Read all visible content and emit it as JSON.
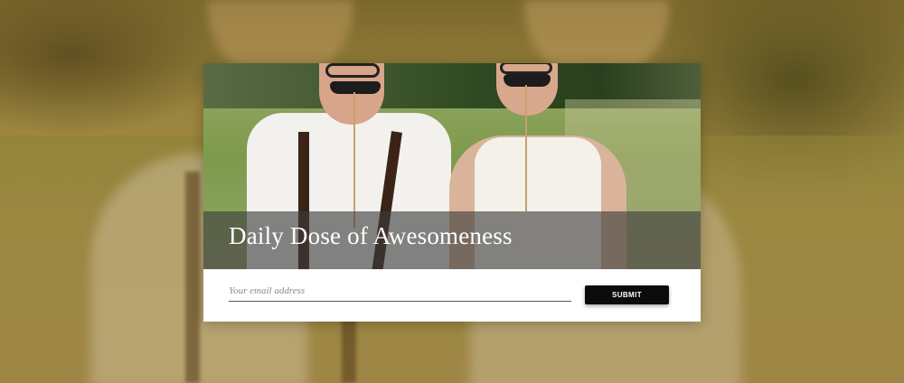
{
  "card": {
    "title": "Daily Dose of Awesomeness",
    "email_placeholder": "Your email address",
    "email_value": "",
    "submit_label": "SUBMIT"
  },
  "colors": {
    "button_bg": "#0b0b0b",
    "button_text": "#ffffff",
    "card_bg": "#ffffff",
    "title_band": "rgba(60,60,60,0.62)"
  }
}
